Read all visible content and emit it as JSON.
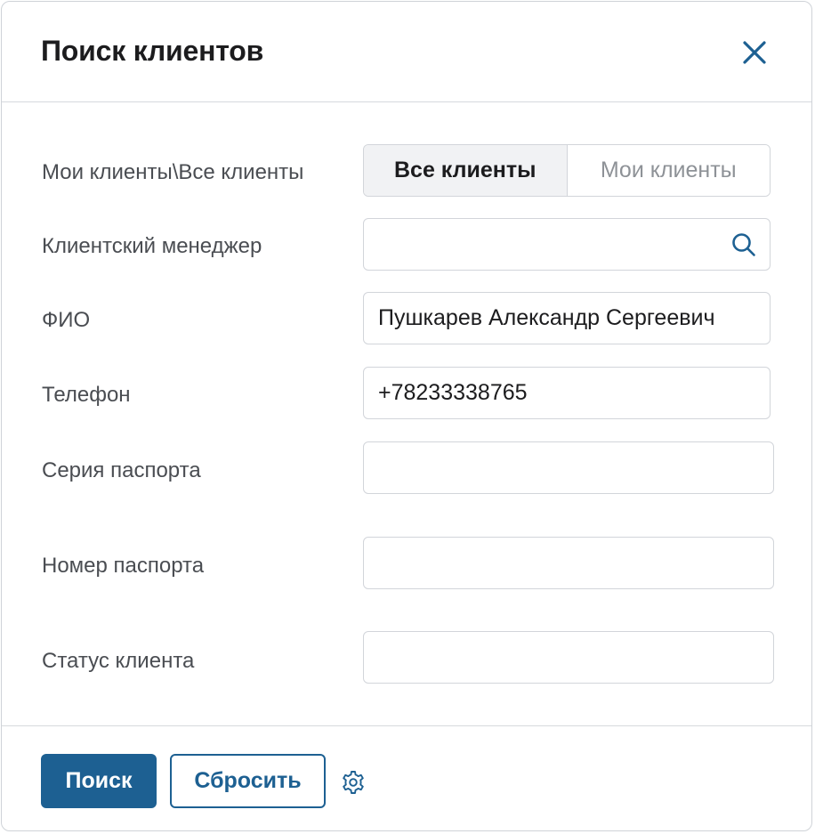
{
  "dialog": {
    "title": "Поиск клиентов"
  },
  "icons": {
    "close": "close-icon",
    "search": "search-icon",
    "settings": "gear-icon"
  },
  "colors": {
    "accent": "#1d6092",
    "border": "#d2d5da",
    "label": "#4a4d52",
    "active_segment_bg": "#f1f2f4"
  },
  "form": {
    "scope": {
      "label": "Мои клиенты\\Все клиенты",
      "options": [
        "Все клиенты",
        "Мои клиенты"
      ],
      "selected": "Все клиенты"
    },
    "manager": {
      "label": "Клиентский менеджер",
      "value": ""
    },
    "fio": {
      "label": "ФИО",
      "value": "Пушкарев Александр Сергеевич"
    },
    "phone": {
      "label": "Телефон",
      "value": "+78233338765"
    },
    "passport_series": {
      "label": "Серия паспорта",
      "value": ""
    },
    "passport_number": {
      "label": "Номер паспорта",
      "value": ""
    },
    "status": {
      "label": "Статус клиента",
      "value": ""
    }
  },
  "footer": {
    "search_label": "Поиск",
    "reset_label": "Сбросить"
  }
}
